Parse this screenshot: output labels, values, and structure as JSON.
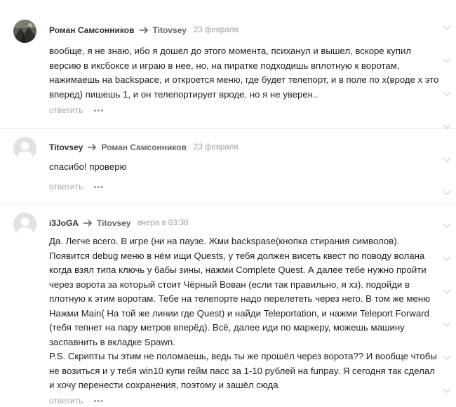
{
  "comments": [
    {
      "author": "Роман Самсонников",
      "reply_to": "Titovsey",
      "date": "23 февраля",
      "avatar": "photo-avatar",
      "text": "вообще, я не знаю, ибо я дошел до этого момента, психанул и вышел, вскоре купил версию в иксбоксе и играю в нее, но, на пиратке подходишь вплотную к воротам, нажимаешь на backspace, и откроется меню, где будет телепорт, и в поле по х(вроде х это вперед) пишешь 1, и он телепортирует вроде. но я не уверен..",
      "reply_label": "ответить"
    },
    {
      "author": "Titovsey",
      "reply_to": "Роман Самсонников",
      "date": "23 февраля",
      "avatar": "default-avatar",
      "text": "спасибо! проверю",
      "reply_label": "ответить"
    },
    {
      "author": "i3JoGA",
      "reply_to": "Titovsey",
      "date": "вчера в 03:38",
      "avatar": "default-avatar",
      "text": "Да. Легче всего. В игре (ни на паузе. Жми backspase(кнопка стирания символов). Появится debug меню в нём ищи Quests, у тебя должен висеть квест по поводу волана когда взял типа ключь у бабы зины, нажми Complete Quest. А далее тебе нужно пройти через ворота за который стоит Чёрный Вован (если так правильно, я хз). подойди в плотную к этим воротам. Тебе на телепорте надо перелететь через него. В том же меню Нажми Main( На той же линии где Quest) и найди Teleportation, и нажми Teleport Forward (тебя тепнет на пару метров вперёд). Всё, далее иди по маркеру, можешь машину заспавнить в вкладке Spawn.\nP.S. Скрипты ты этим не поломаешь, ведь ты же прошёл через ворота?? И вообще чтобы не возиться и у тебя win10 купи гейм пасс за 1-10 рублей на funpay. Я сегодня так сделал и хочу перенести сохранения, поэтому и зашёл сюда",
      "reply_label": "ответить"
    }
  ],
  "colors": {
    "author": "#333333",
    "reply_to": "#666666",
    "date": "#a0a0a0",
    "action": "#a8a8a8",
    "text": "#222222",
    "divider": "#ececec"
  },
  "icons": [
    "photo-avatar",
    "default-avatar-icon",
    "reply-arrow-icon",
    "more-dots-icon",
    "collapse-chevron-icon"
  ]
}
